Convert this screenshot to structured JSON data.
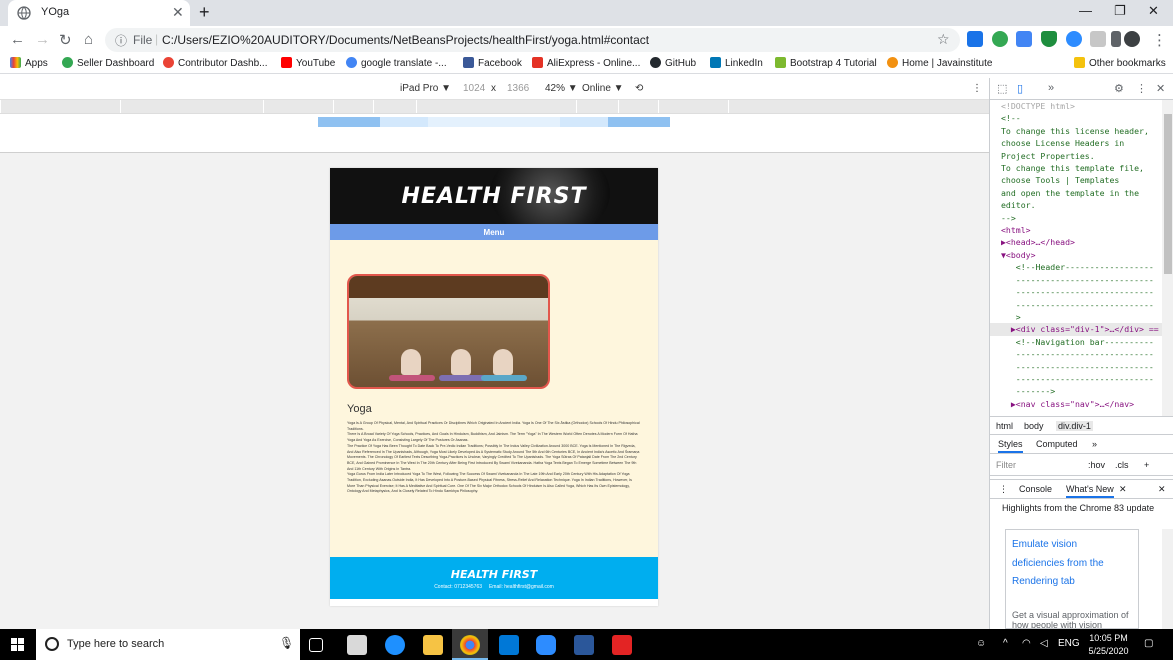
{
  "browser": {
    "tab_title": "YOga",
    "url_scheme": "File",
    "url": "C:/Users/EZIO%20AUDITORY/Documents/NetBeansProjects/healthFirst/yoga.html#contact",
    "bookmarks": [
      "Apps",
      "Seller Dashboard",
      "Contributor Dashb...",
      "YouTube",
      "google translate -...",
      "Facebook",
      "AliExpress - Online...",
      "GitHub",
      "LinkedIn",
      "Bootstrap 4 Tutorial",
      "Home | Javainstitute",
      "Other bookmarks"
    ]
  },
  "device_toolbar": {
    "device": "iPad Pro ▼",
    "width": "1024",
    "times": "x",
    "height": "1366",
    "zoom": "42% ▼",
    "network": "Online ▼"
  },
  "site": {
    "logo": "HEALTH FIRST",
    "menu_label": "Menu",
    "section_title": "Yoga",
    "paragraphs": [
      "Yoga Is A Group Of Physical, Mental, And Spiritual Practices Or Disciplines Which Originated In Ancient India. Yoga Is One Of The Six Āstika (Orthodox) Schools Of Hindu Philosophical Traditions.",
      "There Is A Broad Variety Of Yoga Schools, Practices, And Goals In Hinduism, Buddhism, And Jainism. The Term \"Yoga\" In The Western World Often Denotes A Modern Form Of Hatha Yoga And Yoga As Exercise, Consisting Largely Of The Postures Or Asanas.",
      "The Practice Of Yoga Has Been Thought To Date Back To Pre-Vedic Indian Traditions; Possibly In The Indus Valley Civilization Around 3000 BCE. Yoga Is Mentioned In The Rigveda, And Also Referenced In The Upanishads, Although, Yoga Most Likely Developed As A Systematic Study Around The 5th And 6th Centuries BCE, In Ancient India's Ascetic And Śramaṇa Movements. The Chronology Of Earliest Texts Describing Yoga-Practices Is Unclear, Varyingly Credited To The Upanishads. The Yoga Sūtras Of Patanjali Date From The 2nd Century BCE, And Gained Prominence In The West In The 20th Century After Being First Introduced By Swami Vivekananda. Hatha Yoga Texts Began To Emerge Sometime Between The 9th And 11th Century With Origins In Tantra.",
      "Yoga Gurus From India Later Introduced Yoga To The West, Following The Success Of Swami Vivekananda In The Late 19th And Early 20th Century With His Adaptation Of Yoga Tradition, Excluding Asanas.Outside India, It Has Developed Into A Posture-Based Physical Fitness, Stress-Relief And Relaxation Technique. Yoga In Indian Traditions, However, Is More Than Physical Exercise; It Has A Meditative And Spiritual Core. One Of The Six Major Orthodox Schools Of Hinduism Is Also Called Yoga, Which Has Its Own Epistemology, Ontology And Metaphysics, And Is Closely Related To Hindu Samkhya Philosophy."
    ],
    "footer_logo": "HEALTH FIRST",
    "footer_contact": "Contact: 0712345763",
    "footer_email": "Email: healthfirst@gmail.com"
  },
  "devtools": {
    "code_lines": [
      "<!DOCTYPE html>",
      "<!--",
      "To change this license header,",
      "choose License Headers in",
      "Project Properties.",
      "To change this template file,",
      "choose Tools | Templates",
      "and open the template in the",
      "editor.",
      "-->",
      "<html>",
      "▶<head>…</head>",
      "▼<body>",
      "   <!--Header------------------",
      "   ----------------------------",
      "   ----------------------------",
      "   ----------------------------",
      "   >",
      "  ▶<div class=\"div-1\">…</div> ==",
      "   <!--Navigation bar----------",
      "   ----------------------------",
      "   ----------------------------",
      "   ----------------------------",
      "   ------->",
      "  ▶<nav class=\"nav\">…</nav>"
    ],
    "breadcrumbs": [
      "html",
      "body",
      "div.div-1"
    ],
    "panel_tabs": [
      "Styles",
      "Computed",
      "»"
    ],
    "filter_placeholder": "Filter",
    "hov": ":hov",
    "cls": ".cls",
    "drawer_tabs": [
      "Console",
      "What's New"
    ],
    "highlights": "Highlights from the Chrome 83 update",
    "card_link": "Emulate vision deficiencies from the Rendering tab",
    "card_desc": "Get a visual approximation of how people with vision deficiencies might experience your site."
  },
  "taskbar": {
    "search_placeholder": "Type here to search",
    "time": "10:05 PM",
    "date": "5/25/2020",
    "lang": "ENG"
  }
}
